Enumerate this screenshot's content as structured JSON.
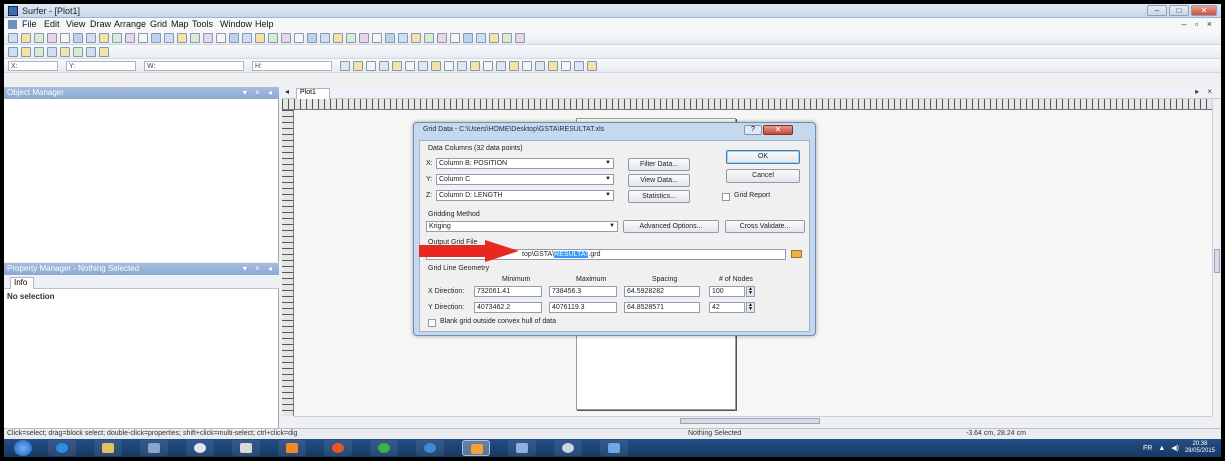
{
  "window": {
    "title": "Surfer - [Plot1]",
    "controls": [
      "–",
      "□",
      "✕"
    ]
  },
  "menu": [
    "File",
    "Edit",
    "View",
    "Draw",
    "Arrange",
    "Grid",
    "Map",
    "Tools",
    "Window",
    "Help"
  ],
  "mdi_controls": "– ▫ ×",
  "toolbar3": {
    "x_combo": "X:",
    "y_combo": "Y:",
    "w_combo": "W:",
    "h_combo": "H:"
  },
  "object_manager": {
    "title": "Object Manager",
    "controls": "▾ × ◂"
  },
  "property_manager": {
    "title": "Property Manager - Nothing Selected",
    "tab": "Info",
    "content": "No selection",
    "controls": "▾ × ◂"
  },
  "document": {
    "tab": "Plot1",
    "nav": "◂",
    "close": "▸ ×"
  },
  "status": {
    "hint": "Click=select; drag=block select; double-click=properties; shift+click=multi-select; ctrl+click=dig",
    "selection": "Nothing Selected",
    "coords": "-3.64 cm, 28.24 cm"
  },
  "tray": {
    "lang": "FR",
    "time": "20:38",
    "date": "28/05/2015"
  },
  "dialog": {
    "title": "Grid Data - C:\\Users\\HOME\\Desktop\\GSTA\\RESULTAT.xls",
    "help": "?",
    "close": "✕",
    "data_columns_label": "Data Columns",
    "data_points": "(32 data points)",
    "x_label": "X:",
    "x_value": "Column B:  POSITION",
    "y_label": "Y:",
    "y_value": "Column C",
    "z_label": "Z:",
    "z_value": "Column D:  LENGTH",
    "filter_btn": "Filter Data...",
    "view_btn": "View Data...",
    "stats_btn": "Statistics...",
    "ok_btn": "OK",
    "cancel_btn": "Cancel",
    "grid_report": "Grid Report",
    "gridding_label": "Gridding Method",
    "gridding_value": "Kriging",
    "advanced_btn": "Advanced Options...",
    "cross_btn": "Cross Validate...",
    "output_label": "Output Grid File",
    "output_prefix": "C:",
    "output_mid": "top\\GSTA\\",
    "output_selected": "RESULTAT",
    "output_ext": ".grd",
    "geometry_label": "Grid Line Geometry",
    "col_min": "Minimum",
    "col_max": "Maximum",
    "col_spacing": "Spacing",
    "col_nodes": "# of Nodes",
    "x_dir": "X Direction:",
    "x_min": "732061.41",
    "x_max": "738456.3",
    "x_spacing": "64.5928282",
    "x_nodes": "100",
    "y_dir": "Y Direction:",
    "y_min": "4073462.2",
    "y_max": "4076119.3",
    "y_spacing": "64.8528571",
    "y_nodes": "42",
    "blank_label": "Blank grid outside convex hull of data"
  },
  "annotation_color": "#e8271e"
}
